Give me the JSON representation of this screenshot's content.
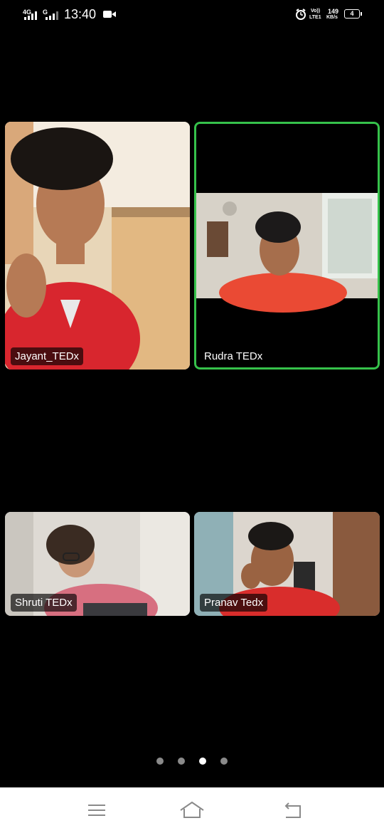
{
  "status_bar": {
    "network_1": "4G",
    "network_2": "G",
    "time": "13:40",
    "volte_top": "Vo))",
    "volte_bottom": "LTE1",
    "speed_value": "149",
    "speed_unit": "KB/s",
    "battery_level": "4"
  },
  "participants": [
    {
      "name": "Jayant_TEDx",
      "active_speaker": false
    },
    {
      "name": "Rudra TEDx",
      "active_speaker": true
    },
    {
      "name": "Shruti TEDx",
      "active_speaker": false
    },
    {
      "name": "Pranav Tedx",
      "active_speaker": false
    }
  ],
  "pagination": {
    "total_pages": 4,
    "current_page": 3
  },
  "colors": {
    "active_speaker_border": "#36c24b",
    "background": "#000000",
    "nav_bar": "#ffffff"
  },
  "nav_icons": [
    "menu-icon",
    "home-icon",
    "back-icon"
  ]
}
